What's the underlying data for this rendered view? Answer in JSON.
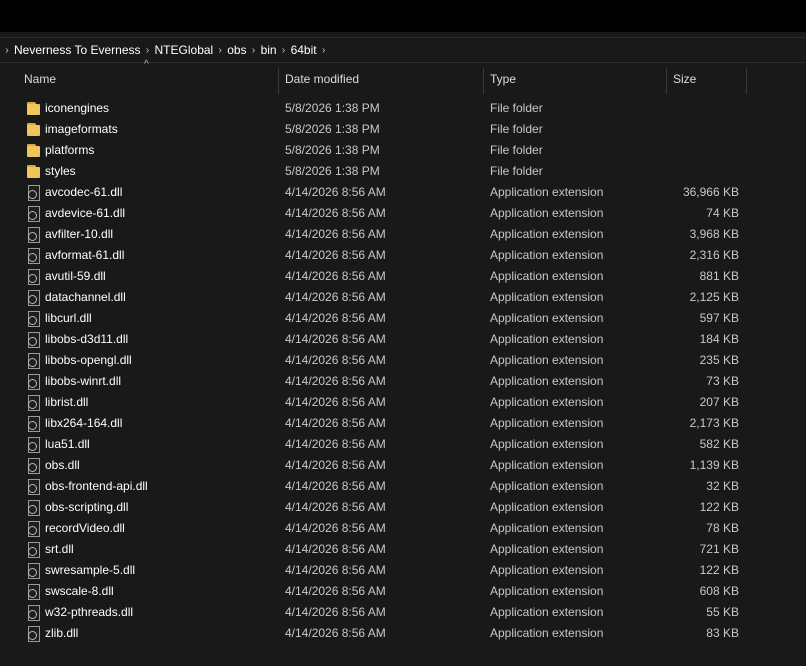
{
  "breadcrumb": [
    "Neverness To Everness",
    "NTEGlobal",
    "obs",
    "bin",
    "64bit"
  ],
  "columns": {
    "name": "Name",
    "date_modified": "Date modified",
    "type": "Type",
    "size": "Size"
  },
  "files": [
    {
      "name": "iconengines",
      "date": "5/8/2026 1:38 PM",
      "type": "File folder",
      "size": "",
      "icon": "folder-icon"
    },
    {
      "name": "imageformats",
      "date": "5/8/2026 1:38 PM",
      "type": "File folder",
      "size": "",
      "icon": "folder-icon"
    },
    {
      "name": "platforms",
      "date": "5/8/2026 1:38 PM",
      "type": "File folder",
      "size": "",
      "icon": "folder-icon"
    },
    {
      "name": "styles",
      "date": "5/8/2026 1:38 PM",
      "type": "File folder",
      "size": "",
      "icon": "folder-icon"
    },
    {
      "name": "avcodec-61.dll",
      "date": "4/14/2026 8:56 AM",
      "type": "Application extension",
      "size": "36,966 KB",
      "icon": "dll-file-icon"
    },
    {
      "name": "avdevice-61.dll",
      "date": "4/14/2026 8:56 AM",
      "type": "Application extension",
      "size": "74 KB",
      "icon": "dll-file-icon"
    },
    {
      "name": "avfilter-10.dll",
      "date": "4/14/2026 8:56 AM",
      "type": "Application extension",
      "size": "3,968 KB",
      "icon": "dll-file-icon"
    },
    {
      "name": "avformat-61.dll",
      "date": "4/14/2026 8:56 AM",
      "type": "Application extension",
      "size": "2,316 KB",
      "icon": "dll-file-icon"
    },
    {
      "name": "avutil-59.dll",
      "date": "4/14/2026 8:56 AM",
      "type": "Application extension",
      "size": "881 KB",
      "icon": "dll-file-icon"
    },
    {
      "name": "datachannel.dll",
      "date": "4/14/2026 8:56 AM",
      "type": "Application extension",
      "size": "2,125 KB",
      "icon": "dll-file-icon"
    },
    {
      "name": "libcurl.dll",
      "date": "4/14/2026 8:56 AM",
      "type": "Application extension",
      "size": "597 KB",
      "icon": "dll-file-icon"
    },
    {
      "name": "libobs-d3d11.dll",
      "date": "4/14/2026 8:56 AM",
      "type": "Application extension",
      "size": "184 KB",
      "icon": "dll-file-icon"
    },
    {
      "name": "libobs-opengl.dll",
      "date": "4/14/2026 8:56 AM",
      "type": "Application extension",
      "size": "235 KB",
      "icon": "dll-file-icon"
    },
    {
      "name": "libobs-winrt.dll",
      "date": "4/14/2026 8:56 AM",
      "type": "Application extension",
      "size": "73 KB",
      "icon": "dll-file-icon"
    },
    {
      "name": "librist.dll",
      "date": "4/14/2026 8:56 AM",
      "type": "Application extension",
      "size": "207 KB",
      "icon": "dll-file-icon"
    },
    {
      "name": "libx264-164.dll",
      "date": "4/14/2026 8:56 AM",
      "type": "Application extension",
      "size": "2,173 KB",
      "icon": "dll-file-icon"
    },
    {
      "name": "lua51.dll",
      "date": "4/14/2026 8:56 AM",
      "type": "Application extension",
      "size": "582 KB",
      "icon": "dll-file-icon"
    },
    {
      "name": "obs.dll",
      "date": "4/14/2026 8:56 AM",
      "type": "Application extension",
      "size": "1,139 KB",
      "icon": "dll-file-icon"
    },
    {
      "name": "obs-frontend-api.dll",
      "date": "4/14/2026 8:56 AM",
      "type": "Application extension",
      "size": "32 KB",
      "icon": "dll-file-icon"
    },
    {
      "name": "obs-scripting.dll",
      "date": "4/14/2026 8:56 AM",
      "type": "Application extension",
      "size": "122 KB",
      "icon": "dll-file-icon"
    },
    {
      "name": "recordVideo.dll",
      "date": "4/14/2026 8:56 AM",
      "type": "Application extension",
      "size": "78 KB",
      "icon": "dll-file-icon"
    },
    {
      "name": "srt.dll",
      "date": "4/14/2026 8:56 AM",
      "type": "Application extension",
      "size": "721 KB",
      "icon": "dll-file-icon"
    },
    {
      "name": "swresample-5.dll",
      "date": "4/14/2026 8:56 AM",
      "type": "Application extension",
      "size": "122 KB",
      "icon": "dll-file-icon"
    },
    {
      "name": "swscale-8.dll",
      "date": "4/14/2026 8:56 AM",
      "type": "Application extension",
      "size": "608 KB",
      "icon": "dll-file-icon"
    },
    {
      "name": "w32-pthreads.dll",
      "date": "4/14/2026 8:56 AM",
      "type": "Application extension",
      "size": "55 KB",
      "icon": "dll-file-icon"
    },
    {
      "name": "zlib.dll",
      "date": "4/14/2026 8:56 AM",
      "type": "Application extension",
      "size": "83 KB",
      "icon": "dll-file-icon"
    }
  ],
  "sort": {
    "column": "name",
    "direction": "ascending"
  },
  "colors": {
    "background": "#191919",
    "folder": "#f2c55c",
    "text": "#ffffff",
    "secondary_text": "#c8c8c8"
  }
}
